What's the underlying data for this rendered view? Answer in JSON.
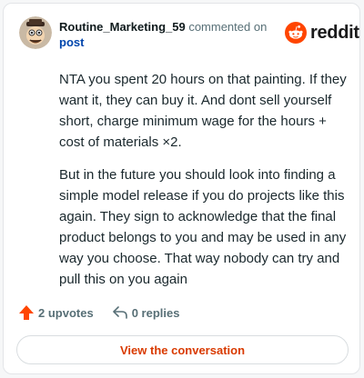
{
  "comment": {
    "username": "Routine_Marketing_59",
    "action_text": " commented on ",
    "post_link": "post",
    "paragraphs": [
      "NTA you spent 20 hours on that painting. If they want it, they can buy it. And dont sell yourself short, charge minimum wage for the hours + cost of materials ×2.",
      "But in the future you should look into finding a simple model release if you do projects like this again. They sign to acknowledge that the final product belongs to you and may be used in any way you choose. That way nobody can try and pull this on you again"
    ]
  },
  "brand": {
    "name": "reddit",
    "color": "#ff4500"
  },
  "actions": {
    "upvotes": "2 upvotes",
    "replies": "0 replies"
  },
  "cta": {
    "label": "View the conversation"
  },
  "colors": {
    "accent": "#d93a00",
    "upvote": "#ff4500",
    "link": "#0045ac",
    "muted": "#576f76"
  }
}
